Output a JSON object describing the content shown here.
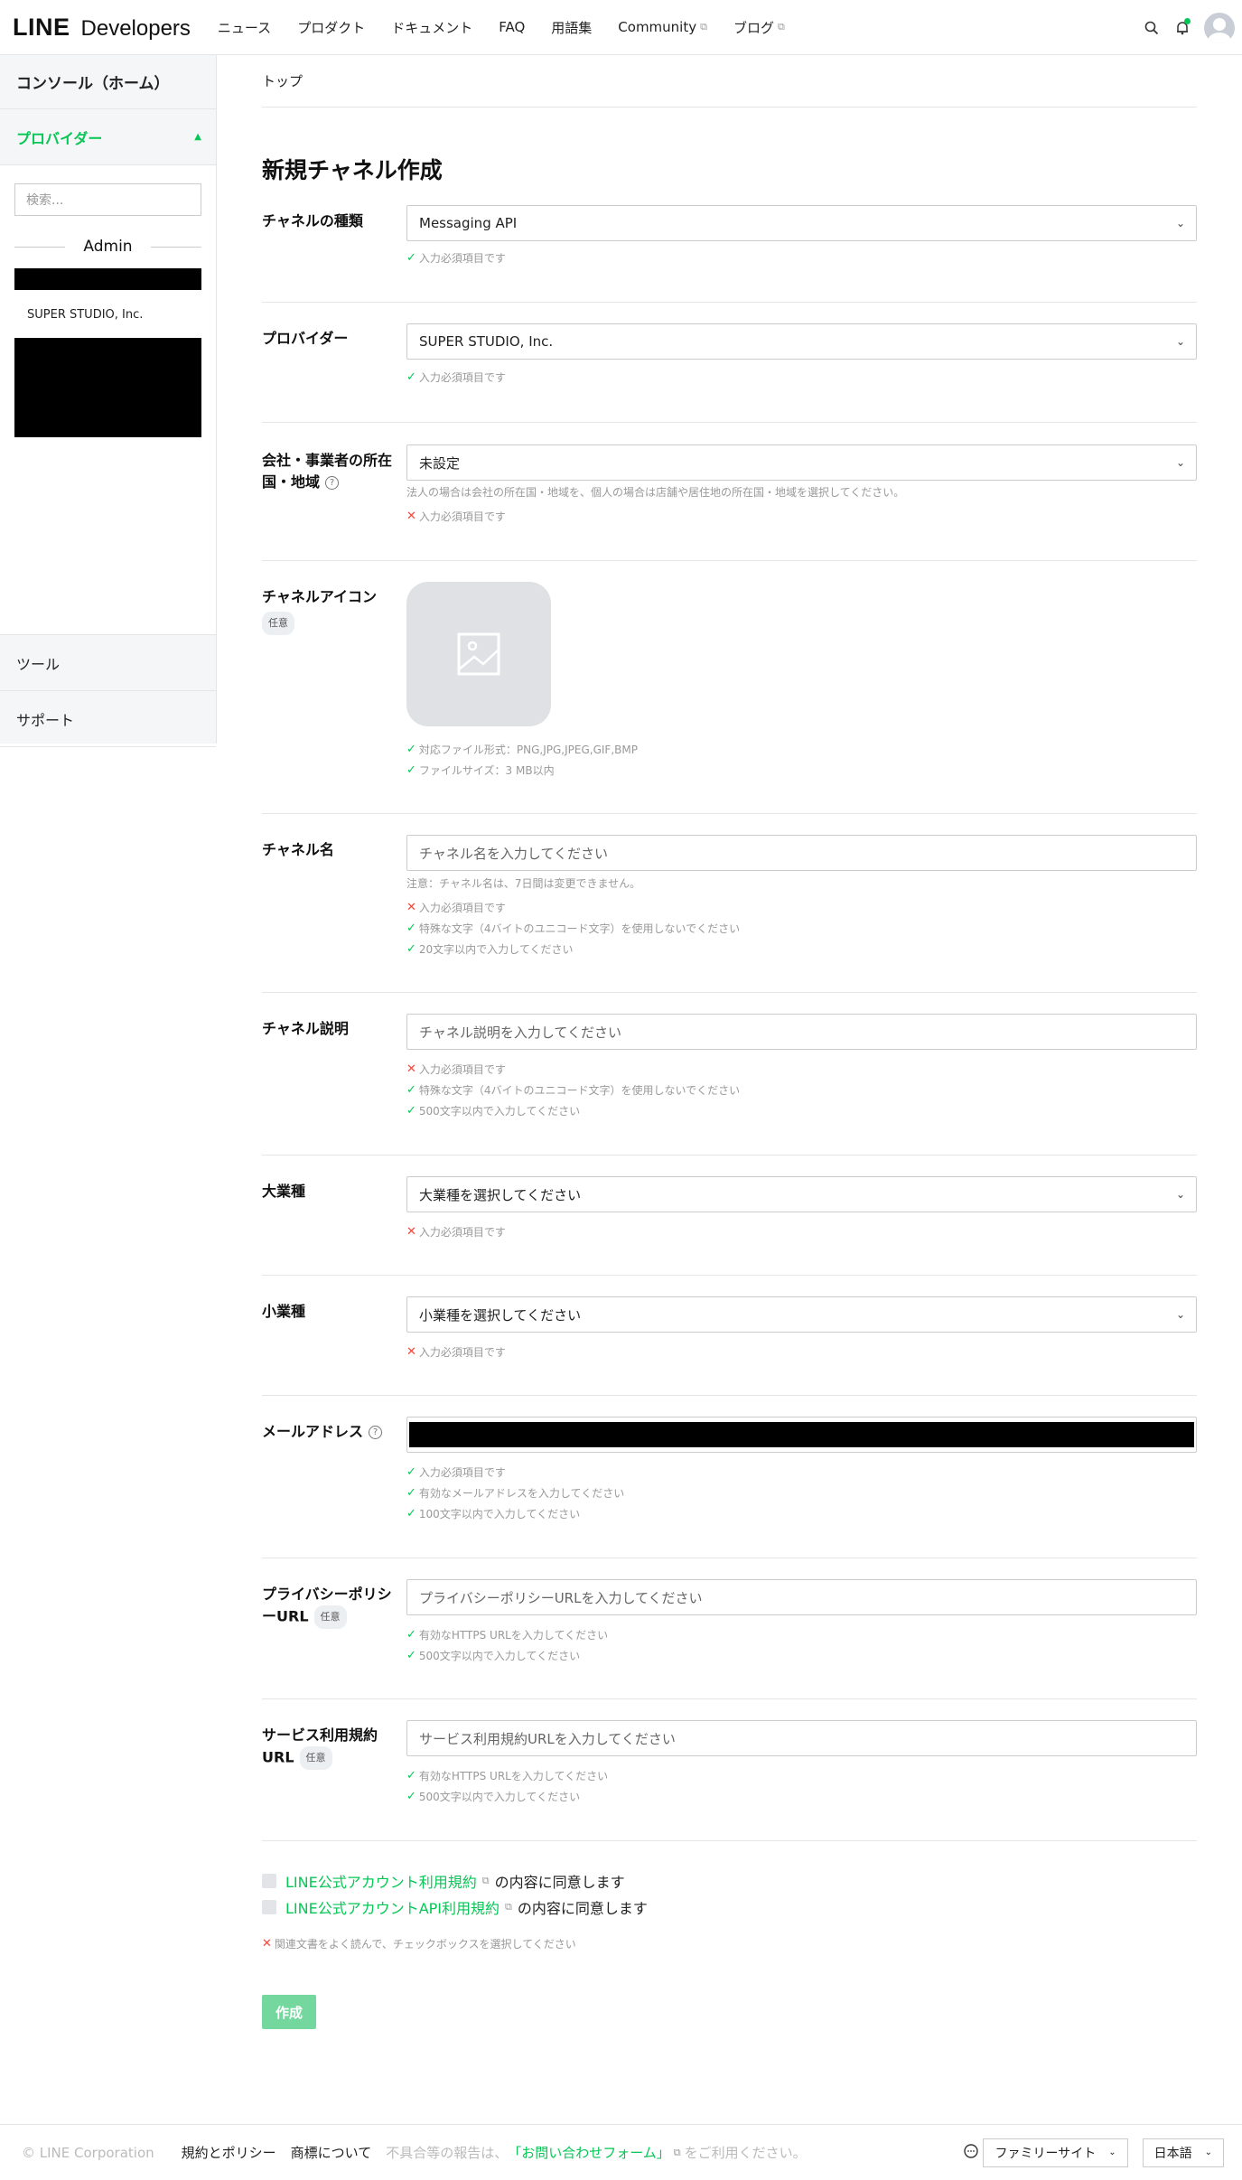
{
  "header": {
    "logo_line": "LINE",
    "logo_developers": "Developers",
    "nav": [
      "ニュース",
      "プロダクト",
      "ドキュメント",
      "FAQ",
      "用語集",
      "Community",
      "ブログ"
    ]
  },
  "sidebar": {
    "console": "コンソール（ホーム）",
    "provider": "プロバイダー",
    "search_placeholder": "検索...",
    "admin": "Admin",
    "company": "SUPER STUDIO, Inc.",
    "tool": "ツール",
    "support": "サポート"
  },
  "main": {
    "breadcrumb": "トップ",
    "title": "新規チャネル作成",
    "channel_type": {
      "label": "チャネルの種類",
      "value": "Messaging API",
      "v1": "入力必須項目です"
    },
    "provider": {
      "label": "プロバイダー",
      "value": "SUPER STUDIO, Inc.",
      "v1": "入力必須項目です"
    },
    "region": {
      "label1": "会社・事業者の所在",
      "label2": "国・地域",
      "value": "未設定",
      "hint": "法人の場合は会社の所在国・地域を、個人の場合は店舗や居住地の所在国・地域を選択してください。",
      "v1": "入力必須項目です"
    },
    "icon": {
      "label": "チャネルアイコン",
      "optional": "任意",
      "v1": "対応ファイル形式：PNG,JPG,JPEG,GIF,BMP",
      "v2": "ファイルサイズ：3 MB以内"
    },
    "channel_name": {
      "label": "チャネル名",
      "placeholder": "チャネル名を入力してください",
      "hint": "注意：チャネル名は、7日間は変更できません。",
      "v1": "入力必須項目です",
      "v2": "特殊な文字（4バイトのユニコード文字）を使用しないでください",
      "v3": "20文字以内で入力してください"
    },
    "channel_desc": {
      "label": "チャネル説明",
      "placeholder": "チャネル説明を入力してください",
      "v1": "入力必須項目です",
      "v2": "特殊な文字（4バイトのユニコード文字）を使用しないでください",
      "v3": "500文字以内で入力してください"
    },
    "industry_major": {
      "label": "大業種",
      "value": "大業種を選択してください",
      "v1": "入力必須項目です"
    },
    "industry_minor": {
      "label": "小業種",
      "value": "小業種を選択してください",
      "v1": "入力必須項目です"
    },
    "email": {
      "label": "メールアドレス",
      "v1": "入力必須項目です",
      "v2": "有効なメールアドレスを入力してください",
      "v3": "100文字以内で入力してください"
    },
    "privacy": {
      "label1": "プライバシーポリシ",
      "label2": "ーURL",
      "optional": "任意",
      "placeholder": "プライバシーポリシーURLを入力してください",
      "v1": "有効なHTTPS URLを入力してください",
      "v2": "500文字以内で入力してください"
    },
    "terms": {
      "label1": "サービス利用規約",
      "label2": "URL",
      "optional": "任意",
      "placeholder": "サービス利用規約URLを入力してください",
      "v1": "有効なHTTPS URLを入力してください",
      "v2": "500文字以内で入力してください"
    },
    "agree1_link": "LINE公式アカウント利用規約",
    "agree2_link": "LINE公式アカウントAPI利用規約",
    "agree_suffix": "の内容に同意します",
    "agree_error": "関連文書をよく読んで、チェックボックスを選択してください",
    "create": "作成"
  },
  "footer": {
    "copyright": "© LINE Corporation",
    "terms": "規約とポリシー",
    "trademark": "商標について",
    "note_pre": "不具合等の報告は、",
    "note_link": "「お問い合わせフォーム」",
    "note_post": "をご利用ください。",
    "family": "ファミリーサイト",
    "lang": "日本語"
  },
  "colors": {
    "accent": "#06c755",
    "error": "#f0483e"
  }
}
